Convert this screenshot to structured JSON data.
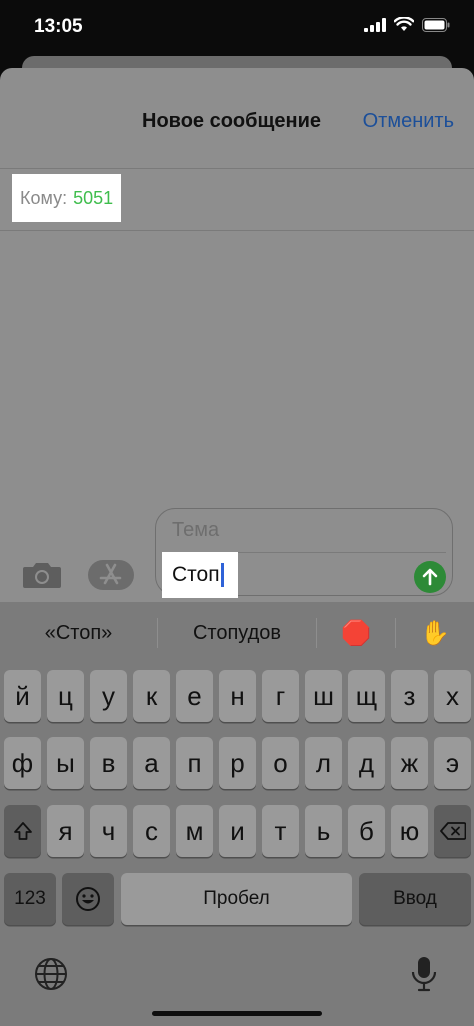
{
  "status_bar": {
    "time": "13:05"
  },
  "nav": {
    "title": "Новое сообщение",
    "cancel_label": "Отменить"
  },
  "recipient": {
    "label": "Кому:",
    "value": "5051"
  },
  "compose": {
    "subject_placeholder": "Тема",
    "message_text": "Стоп"
  },
  "suggestions": [
    "«Стоп»",
    "Стопудов",
    "🛑",
    "✋"
  ],
  "keyboard": {
    "row1": [
      "й",
      "ц",
      "у",
      "к",
      "е",
      "н",
      "г",
      "ш",
      "щ",
      "з",
      "х"
    ],
    "row2": [
      "ф",
      "ы",
      "в",
      "а",
      "п",
      "р",
      "о",
      "л",
      "д",
      "ж",
      "э"
    ],
    "row3": [
      "я",
      "ч",
      "с",
      "м",
      "и",
      "т",
      "ь",
      "б",
      "ю"
    ],
    "numbers_label": "123",
    "space_label": "Пробел",
    "return_label": "Ввод"
  },
  "icons": {
    "camera": "camera-icon",
    "appstore": "app-store-icon",
    "send": "send-arrow-icon",
    "shift": "shift-icon",
    "delete": "delete-icon",
    "emoji": "emoji-icon",
    "globe": "globe-icon",
    "mic": "microphone-icon"
  },
  "colors": {
    "accent": "#1c4f99",
    "recipient": "#3fbd4d",
    "send": "#2d8a37",
    "cursor": "#2e62d8"
  }
}
